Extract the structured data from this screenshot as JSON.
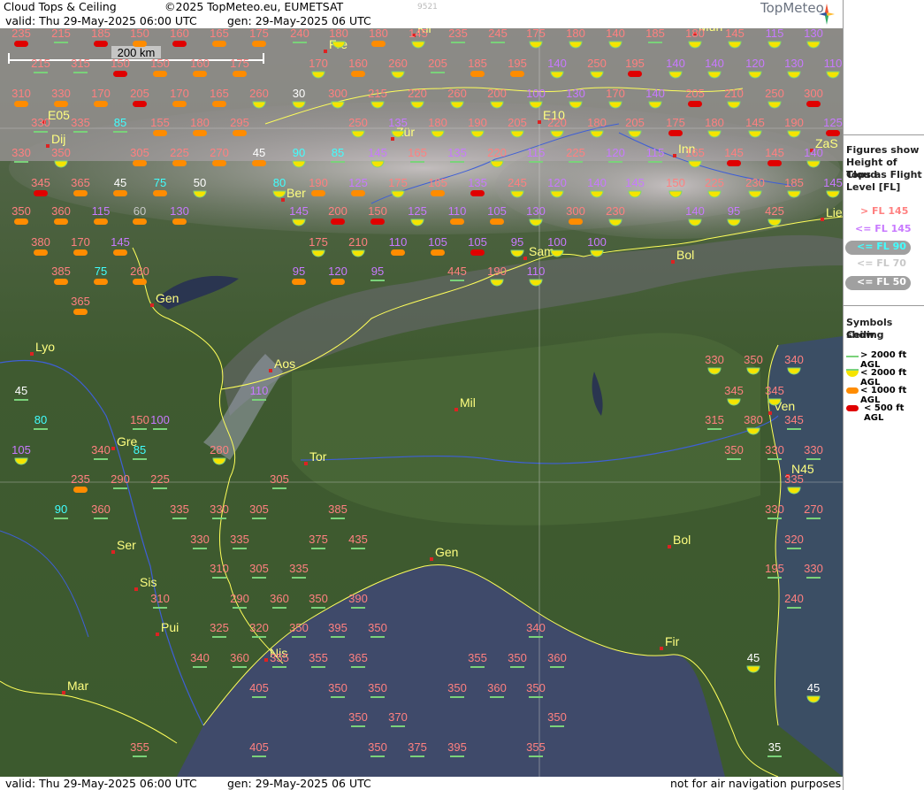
{
  "header": {
    "title": "Cloud Tops & Ceiling",
    "copyright": "©2025 TopMeteo.eu, EUMETSAT",
    "code": "9521",
    "valid": "valid:  Thu  29-May-2025  06:00 UTC",
    "gen": "gen:  29-May-2025 06 UTC",
    "logo": "TopMeteo"
  },
  "footer": {
    "valid": "valid:  Thu  29-May-2025  06:00 UTC",
    "gen": "gen:  29-May-2025 06 UTC",
    "disclaimer": "not for air navigation purposes"
  },
  "scale_bar": {
    "label": "200 km"
  },
  "legend": {
    "figures_title": [
      "Figures show",
      "Height of Cloud",
      "Tops as Flight",
      "Level  [FL]"
    ],
    "levels": [
      {
        "label": "> FL 145",
        "color": "#ff8080"
      },
      {
        "label": "<= FL 145",
        "color": "#c879ff"
      },
      {
        "label": "<= FL 90",
        "color": "#40ffff"
      },
      {
        "label": "<= FL 70",
        "color": "#c8c8c8"
      },
      {
        "label": "<= FL 50",
        "color": "#ffffff"
      }
    ],
    "symbols_title": [
      "Symbols show",
      "Ceiling"
    ],
    "symbols": [
      {
        "label": "> 2000 ft AGL",
        "kind": "green"
      },
      {
        "label": "< 2000 ft AGL",
        "kind": "yellow"
      },
      {
        "label": "< 1000 ft AGL",
        "kind": "orange"
      },
      {
        "label": "< 500 ft AGL",
        "kind": "red"
      }
    ]
  },
  "colors": {
    "pink": "#ff8080",
    "violet": "#c879ff",
    "cyan": "#40ffff",
    "grey": "#c8c8c8",
    "white": "#ffffff",
    "ceil_green": "#7ad27a",
    "ceil_yellow": "#f5e400",
    "ceil_orange": "#ff8c00",
    "ceil_red": "#e00000",
    "city_label": "#ffff80"
  },
  "cities": [
    "Mun",
    "Fre",
    "Kli",
    "E05",
    "Dij",
    "Zür",
    "E10",
    "Inn",
    "ZaS",
    "Ber",
    "Lie",
    "Sam",
    "Bol",
    "Gen",
    "Lyo",
    "Aos",
    "Mil",
    "Ven",
    "Gre",
    "Tor",
    "N45",
    "Ser",
    "Gen",
    "Bol",
    "Sis",
    "Pui",
    "Nis",
    "Fir",
    "Mar"
  ],
  "stations": [
    [
      "235",
      "pink",
      "red"
    ],
    [
      "215",
      "pink",
      "green"
    ],
    [
      "185",
      "pink",
      "red"
    ],
    [
      "150",
      "pink",
      "orange"
    ],
    [
      "160",
      "pink",
      "red"
    ],
    [
      "165",
      "pink",
      "orange"
    ],
    [
      "175",
      "pink",
      "orange"
    ],
    [
      "240",
      "pink",
      "green"
    ],
    [
      "180",
      "pink",
      "yellow"
    ],
    [
      "180",
      "pink",
      "orange"
    ],
    [
      "145",
      "pink",
      "yellow"
    ],
    [
      "235",
      "pink",
      "green"
    ],
    [
      "245",
      "pink",
      "green"
    ],
    [
      "175",
      "pink",
      "yellow"
    ],
    [
      "180",
      "pink",
      "yellow"
    ],
    [
      "140",
      "pink",
      "yellow"
    ],
    [
      "185",
      "pink",
      "green"
    ],
    [
      "180",
      "pink",
      "yellow"
    ],
    [
      "145",
      "pink",
      "yellow"
    ],
    [
      "115",
      "violet",
      "yellow"
    ],
    [
      "130",
      "violet",
      "yellow"
    ],
    [
      "215",
      "pink",
      "green"
    ],
    [
      "315",
      "pink",
      "green"
    ],
    [
      "150",
      "pink",
      "red"
    ],
    [
      "150",
      "pink",
      "orange"
    ],
    [
      "160",
      "pink",
      "orange"
    ],
    [
      "175",
      "pink",
      "orange"
    ],
    [
      "170",
      "pink",
      "yellow"
    ],
    [
      "160",
      "pink",
      "orange"
    ],
    [
      "260",
      "pink",
      "yellow"
    ],
    [
      "205",
      "pink",
      "green"
    ],
    [
      "185",
      "pink",
      "orange"
    ],
    [
      "195",
      "pink",
      "orange"
    ],
    [
      "140",
      "violet",
      "yellow"
    ],
    [
      "250",
      "pink",
      "yellow"
    ],
    [
      "195",
      "pink",
      "red"
    ],
    [
      "140",
      "violet",
      "yellow"
    ],
    [
      "140",
      "violet",
      "yellow"
    ],
    [
      "120",
      "violet",
      "yellow"
    ],
    [
      "130",
      "violet",
      "yellow"
    ],
    [
      "110",
      "violet",
      "yellow"
    ],
    [
      "310",
      "pink",
      "orange"
    ],
    [
      "330",
      "pink",
      "orange"
    ],
    [
      "170",
      "pink",
      "orange"
    ],
    [
      "205",
      "pink",
      "red"
    ],
    [
      "170",
      "pink",
      "orange"
    ],
    [
      "165",
      "pink",
      "orange"
    ],
    [
      "260",
      "pink",
      "yellow"
    ],
    [
      "30",
      "white",
      "yellow"
    ],
    [
      "300",
      "pink",
      "yellow"
    ],
    [
      "215",
      "pink",
      "yellow"
    ],
    [
      "220",
      "pink",
      "yellow"
    ],
    [
      "260",
      "pink",
      "yellow"
    ],
    [
      "200",
      "pink",
      "yellow"
    ],
    [
      "100",
      "violet",
      "yellow"
    ],
    [
      "130",
      "violet",
      "yellow"
    ],
    [
      "170",
      "pink",
      "yellow"
    ],
    [
      "140",
      "violet",
      "yellow"
    ],
    [
      "205",
      "pink",
      "red"
    ],
    [
      "210",
      "pink",
      "yellow"
    ],
    [
      "250",
      "pink",
      "yellow"
    ],
    [
      "300",
      "pink",
      "red"
    ],
    [
      "330",
      "pink",
      "green"
    ],
    [
      "335",
      "pink",
      "green"
    ],
    [
      "85",
      "cyan",
      "green"
    ],
    [
      "155",
      "pink",
      "orange"
    ],
    [
      "180",
      "pink",
      "orange"
    ],
    [
      "295",
      "pink",
      "orange"
    ],
    [
      "250",
      "pink",
      "yellow"
    ],
    [
      "135",
      "violet",
      "yellow"
    ],
    [
      "180",
      "pink",
      "yellow"
    ],
    [
      "190",
      "pink",
      "yellow"
    ],
    [
      "205",
      "pink",
      "yellow"
    ],
    [
      "220",
      "pink",
      "yellow"
    ],
    [
      "180",
      "pink",
      "yellow"
    ],
    [
      "205",
      "pink",
      "yellow"
    ],
    [
      "175",
      "pink",
      "red"
    ],
    [
      "180",
      "pink",
      "yellow"
    ],
    [
      "145",
      "pink",
      "yellow"
    ],
    [
      "190",
      "pink",
      "yellow"
    ],
    [
      "125",
      "violet",
      "red"
    ],
    [
      "330",
      "pink",
      "green"
    ],
    [
      "350",
      "pink",
      "yellow"
    ],
    [
      "305",
      "pink",
      "orange"
    ],
    [
      "225",
      "pink",
      "orange"
    ],
    [
      "270",
      "pink",
      "orange"
    ],
    [
      "45",
      "white",
      "orange"
    ],
    [
      "90",
      "cyan",
      "yellow"
    ],
    [
      "85",
      "cyan",
      "green"
    ],
    [
      "145",
      "violet",
      "yellow"
    ],
    [
      "165",
      "pink",
      "green"
    ],
    [
      "135",
      "violet",
      "green"
    ],
    [
      "220",
      "pink",
      "yellow"
    ],
    [
      "115",
      "violet",
      "green"
    ],
    [
      "225",
      "pink",
      "green"
    ],
    [
      "120",
      "violet",
      "green"
    ],
    [
      "115",
      "violet",
      "green"
    ],
    [
      "165",
      "pink",
      "yellow"
    ],
    [
      "145",
      "pink",
      "red"
    ],
    [
      "145",
      "pink",
      "red"
    ],
    [
      "140",
      "violet",
      "yellow"
    ],
    [
      "345",
      "pink",
      "red"
    ],
    [
      "365",
      "pink",
      "orange"
    ],
    [
      "45",
      "white",
      "orange"
    ],
    [
      "75",
      "cyan",
      "orange"
    ],
    [
      "50",
      "white",
      "yellow"
    ],
    [
      "80",
      "cyan",
      "yellow"
    ],
    [
      "190",
      "pink",
      "orange"
    ],
    [
      "125",
      "violet",
      "orange"
    ],
    [
      "175",
      "pink",
      "yellow"
    ],
    [
      "165",
      "pink",
      "orange"
    ],
    [
      "135",
      "violet",
      "red"
    ],
    [
      "245",
      "pink",
      "yellow"
    ],
    [
      "120",
      "violet",
      "yellow"
    ],
    [
      "140",
      "violet",
      "yellow"
    ],
    [
      "145",
      "violet",
      "yellow"
    ],
    [
      "150",
      "pink",
      "yellow"
    ],
    [
      "225",
      "pink",
      "yellow"
    ],
    [
      "230",
      "pink",
      "yellow"
    ],
    [
      "185",
      "pink",
      "yellow"
    ],
    [
      "145",
      "violet",
      "yellow"
    ],
    [
      "350",
      "pink",
      "orange"
    ],
    [
      "360",
      "pink",
      "orange"
    ],
    [
      "115",
      "violet",
      "orange"
    ],
    [
      "60",
      "grey",
      "orange"
    ],
    [
      "130",
      "violet",
      "orange"
    ],
    [
      "145",
      "violet",
      "yellow"
    ],
    [
      "200",
      "pink",
      "red"
    ],
    [
      "150",
      "pink",
      "red"
    ],
    [
      "125",
      "violet",
      "yellow"
    ],
    [
      "110",
      "violet",
      "orange"
    ],
    [
      "105",
      "violet",
      "orange"
    ],
    [
      "130",
      "violet",
      "yellow"
    ],
    [
      "300",
      "pink",
      "orange"
    ],
    [
      "230",
      "pink",
      "yellow"
    ],
    [
      "140",
      "violet",
      "yellow"
    ],
    [
      "95",
      "violet",
      "yellow"
    ],
    [
      "425",
      "pink",
      "yellow"
    ],
    [
      "380",
      "pink",
      "orange"
    ],
    [
      "170",
      "pink",
      "orange"
    ],
    [
      "145",
      "violet",
      "orange"
    ],
    [
      "175",
      "pink",
      "yellow"
    ],
    [
      "210",
      "pink",
      "yellow"
    ],
    [
      "110",
      "violet",
      "orange"
    ],
    [
      "105",
      "violet",
      "orange"
    ],
    [
      "105",
      "violet",
      "red"
    ],
    [
      "95",
      "violet",
      "yellow"
    ],
    [
      "100",
      "violet",
      "yellow"
    ],
    [
      "100",
      "violet",
      "yellow"
    ],
    [
      "385",
      "pink",
      "orange"
    ],
    [
      "75",
      "cyan",
      "orange"
    ],
    [
      "260",
      "pink",
      "orange"
    ],
    [
      "95",
      "violet",
      "orange"
    ],
    [
      "120",
      "violet",
      "orange"
    ],
    [
      "95",
      "violet",
      "green"
    ],
    [
      "445",
      "pink",
      "green"
    ],
    [
      "190",
      "pink",
      "yellow"
    ],
    [
      "110",
      "violet",
      "yellow"
    ],
    [
      "365",
      "pink",
      "orange"
    ],
    [
      "330",
      "pink",
      "yellow"
    ],
    [
      "350",
      "pink",
      "yellow"
    ],
    [
      "340",
      "pink",
      "yellow"
    ],
    [
      "45",
      "white",
      "green"
    ],
    [
      "110",
      "violet",
      "green"
    ],
    [
      "345",
      "pink",
      "yellow"
    ],
    [
      "345",
      "pink",
      "yellow"
    ],
    [
      "80",
      "cyan",
      "green"
    ],
    [
      "150",
      "pink",
      "green"
    ],
    [
      "100",
      "violet",
      "green"
    ],
    [
      "315",
      "pink",
      "green"
    ],
    [
      "380",
      "pink",
      "yellow"
    ],
    [
      "345",
      "pink",
      "green"
    ],
    [
      "105",
      "violet",
      "yellow"
    ],
    [
      "340",
      "pink",
      "green"
    ],
    [
      "85",
      "cyan",
      "green"
    ],
    [
      "280",
      "pink",
      "yellow"
    ],
    [
      "350",
      "pink",
      "green"
    ],
    [
      "330",
      "pink",
      "green"
    ],
    [
      "330",
      "pink",
      "green"
    ],
    [
      "235",
      "pink",
      "orange"
    ],
    [
      "290",
      "pink",
      "green"
    ],
    [
      "225",
      "pink",
      "green"
    ],
    [
      "305",
      "pink",
      "green"
    ],
    [
      "335",
      "pink",
      "yellow"
    ],
    [
      "90",
      "cyan",
      "green"
    ],
    [
      "360",
      "pink",
      "green"
    ],
    [
      "335",
      "pink",
      "green"
    ],
    [
      "330",
      "pink",
      "green"
    ],
    [
      "305",
      "pink",
      "green"
    ],
    [
      "385",
      "pink",
      "green"
    ],
    [
      "330",
      "pink",
      "green"
    ],
    [
      "270",
      "pink",
      "green"
    ],
    [
      "330",
      "pink",
      "green"
    ],
    [
      "335",
      "pink",
      "green"
    ],
    [
      "375",
      "pink",
      "green"
    ],
    [
      "435",
      "pink",
      "green"
    ],
    [
      "320",
      "pink",
      "green"
    ],
    [
      "310",
      "pink",
      "green"
    ],
    [
      "305",
      "pink",
      "green"
    ],
    [
      "335",
      "pink",
      "green"
    ],
    [
      "195",
      "pink",
      "green"
    ],
    [
      "330",
      "pink",
      "green"
    ],
    [
      "310",
      "pink",
      "green"
    ],
    [
      "290",
      "pink",
      "green"
    ],
    [
      "360",
      "pink",
      "green"
    ],
    [
      "350",
      "pink",
      "green"
    ],
    [
      "390",
      "pink",
      "green"
    ],
    [
      "240",
      "pink",
      "green"
    ],
    [
      "325",
      "pink",
      "green"
    ],
    [
      "320",
      "pink",
      "green"
    ],
    [
      "350",
      "pink",
      "green"
    ],
    [
      "395",
      "pink",
      "green"
    ],
    [
      "350",
      "pink",
      "green"
    ],
    [
      "340",
      "pink",
      "green"
    ],
    [
      "340",
      "pink",
      "green"
    ],
    [
      "360",
      "pink",
      "green"
    ],
    [
      "355",
      "pink",
      "green"
    ],
    [
      "355",
      "pink",
      "green"
    ],
    [
      "365",
      "pink",
      "green"
    ],
    [
      "355",
      "pink",
      "green"
    ],
    [
      "350",
      "pink",
      "green"
    ],
    [
      "360",
      "pink",
      "green"
    ],
    [
      "45",
      "white",
      "yellow"
    ],
    [
      "405",
      "pink",
      "green"
    ],
    [
      "350",
      "pink",
      "green"
    ],
    [
      "350",
      "pink",
      "green"
    ],
    [
      "350",
      "pink",
      "green"
    ],
    [
      "360",
      "pink",
      "green"
    ],
    [
      "350",
      "pink",
      "green"
    ],
    [
      "45",
      "white",
      "yellow"
    ],
    [
      "350",
      "pink",
      "green"
    ],
    [
      "370",
      "pink",
      "green"
    ],
    [
      "350",
      "pink",
      "green"
    ],
    [
      "355",
      "pink",
      "green"
    ],
    [
      "405",
      "pink",
      "green"
    ],
    [
      "350",
      "pink",
      "green"
    ],
    [
      "375",
      "pink",
      "green"
    ],
    [
      "395",
      "pink",
      "green"
    ],
    [
      "355",
      "pink",
      "green"
    ],
    [
      "35",
      "white",
      "green"
    ]
  ]
}
